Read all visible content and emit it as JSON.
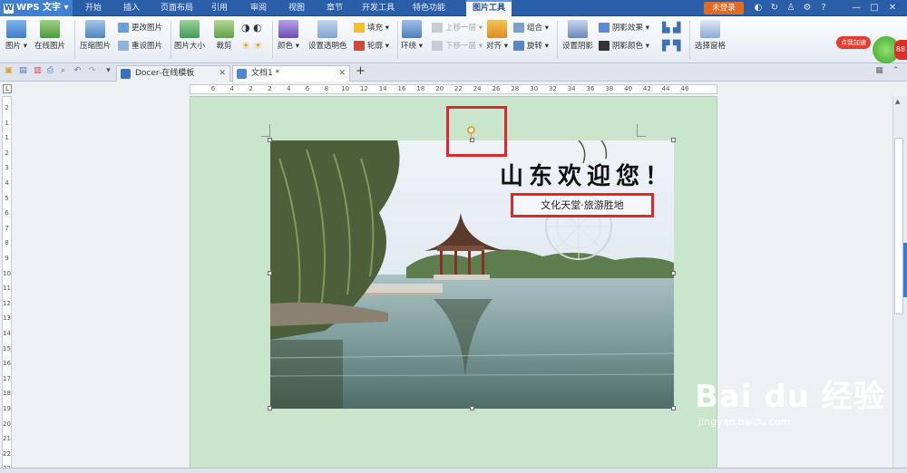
{
  "app": {
    "logo_label": "WPS 文字",
    "login_label": "未登录"
  },
  "menu_tabs": [
    "开始",
    "插入",
    "页面布局",
    "引用",
    "审阅",
    "视图",
    "章节",
    "开发工具",
    "特色功能",
    "图片工具"
  ],
  "active_tab": "图片工具",
  "ribbon": {
    "picture": "图片",
    "online_picture": "在线图片",
    "compress": "压缩图片",
    "change": "更改图片",
    "reset": "重设图片",
    "picture_size": "图片大小",
    "crop": "裁剪",
    "color": "颜色",
    "set_transparent": "设置透明色",
    "fill": "填充",
    "outline": "轮廓",
    "wrap": "环绕",
    "bring_forward": "上移一层",
    "send_backward": "下移一层",
    "align": "对齐",
    "group": "组合",
    "rotate": "旋转",
    "set_shadow": "设置阴影",
    "shadow_effect": "阴影效果",
    "shadow_color": "阴影颜色",
    "select_pane": "选择窗格",
    "promo_badge": "点我加速",
    "promo_number": "88"
  },
  "doc_tabs": [
    {
      "label": "Docer-在线模板",
      "active": false
    },
    {
      "label": "文档1 *",
      "active": true
    }
  ],
  "add_tab": "+",
  "ruler": {
    "h_ticks": [
      "6",
      "4",
      "2",
      "2",
      "4",
      "6",
      "8",
      "10",
      "12",
      "14",
      "16",
      "18",
      "20",
      "22",
      "24",
      "26",
      "28",
      "30",
      "32",
      "34",
      "36",
      "38",
      "40",
      "42",
      "44",
      "46"
    ],
    "v_ticks": [
      "2",
      "1",
      "1",
      "2",
      "3",
      "4",
      "5",
      "6",
      "7",
      "8",
      "9",
      "10",
      "11",
      "12",
      "13",
      "14",
      "15",
      "16",
      "17",
      "18",
      "19",
      "20",
      "21",
      "22",
      "23"
    ]
  },
  "image": {
    "headline": "山东欢迎您！",
    "subtitle": "文化天堂·旅游胜地"
  },
  "watermark": {
    "main": "Bai du 经验",
    "sub": "jingyan.baidu.com"
  },
  "colors": {
    "title_bar": "#2a5ea8",
    "login_orange": "#e36a25",
    "annotation_red": "#e0262a",
    "page_green": "#c9e6cc"
  }
}
